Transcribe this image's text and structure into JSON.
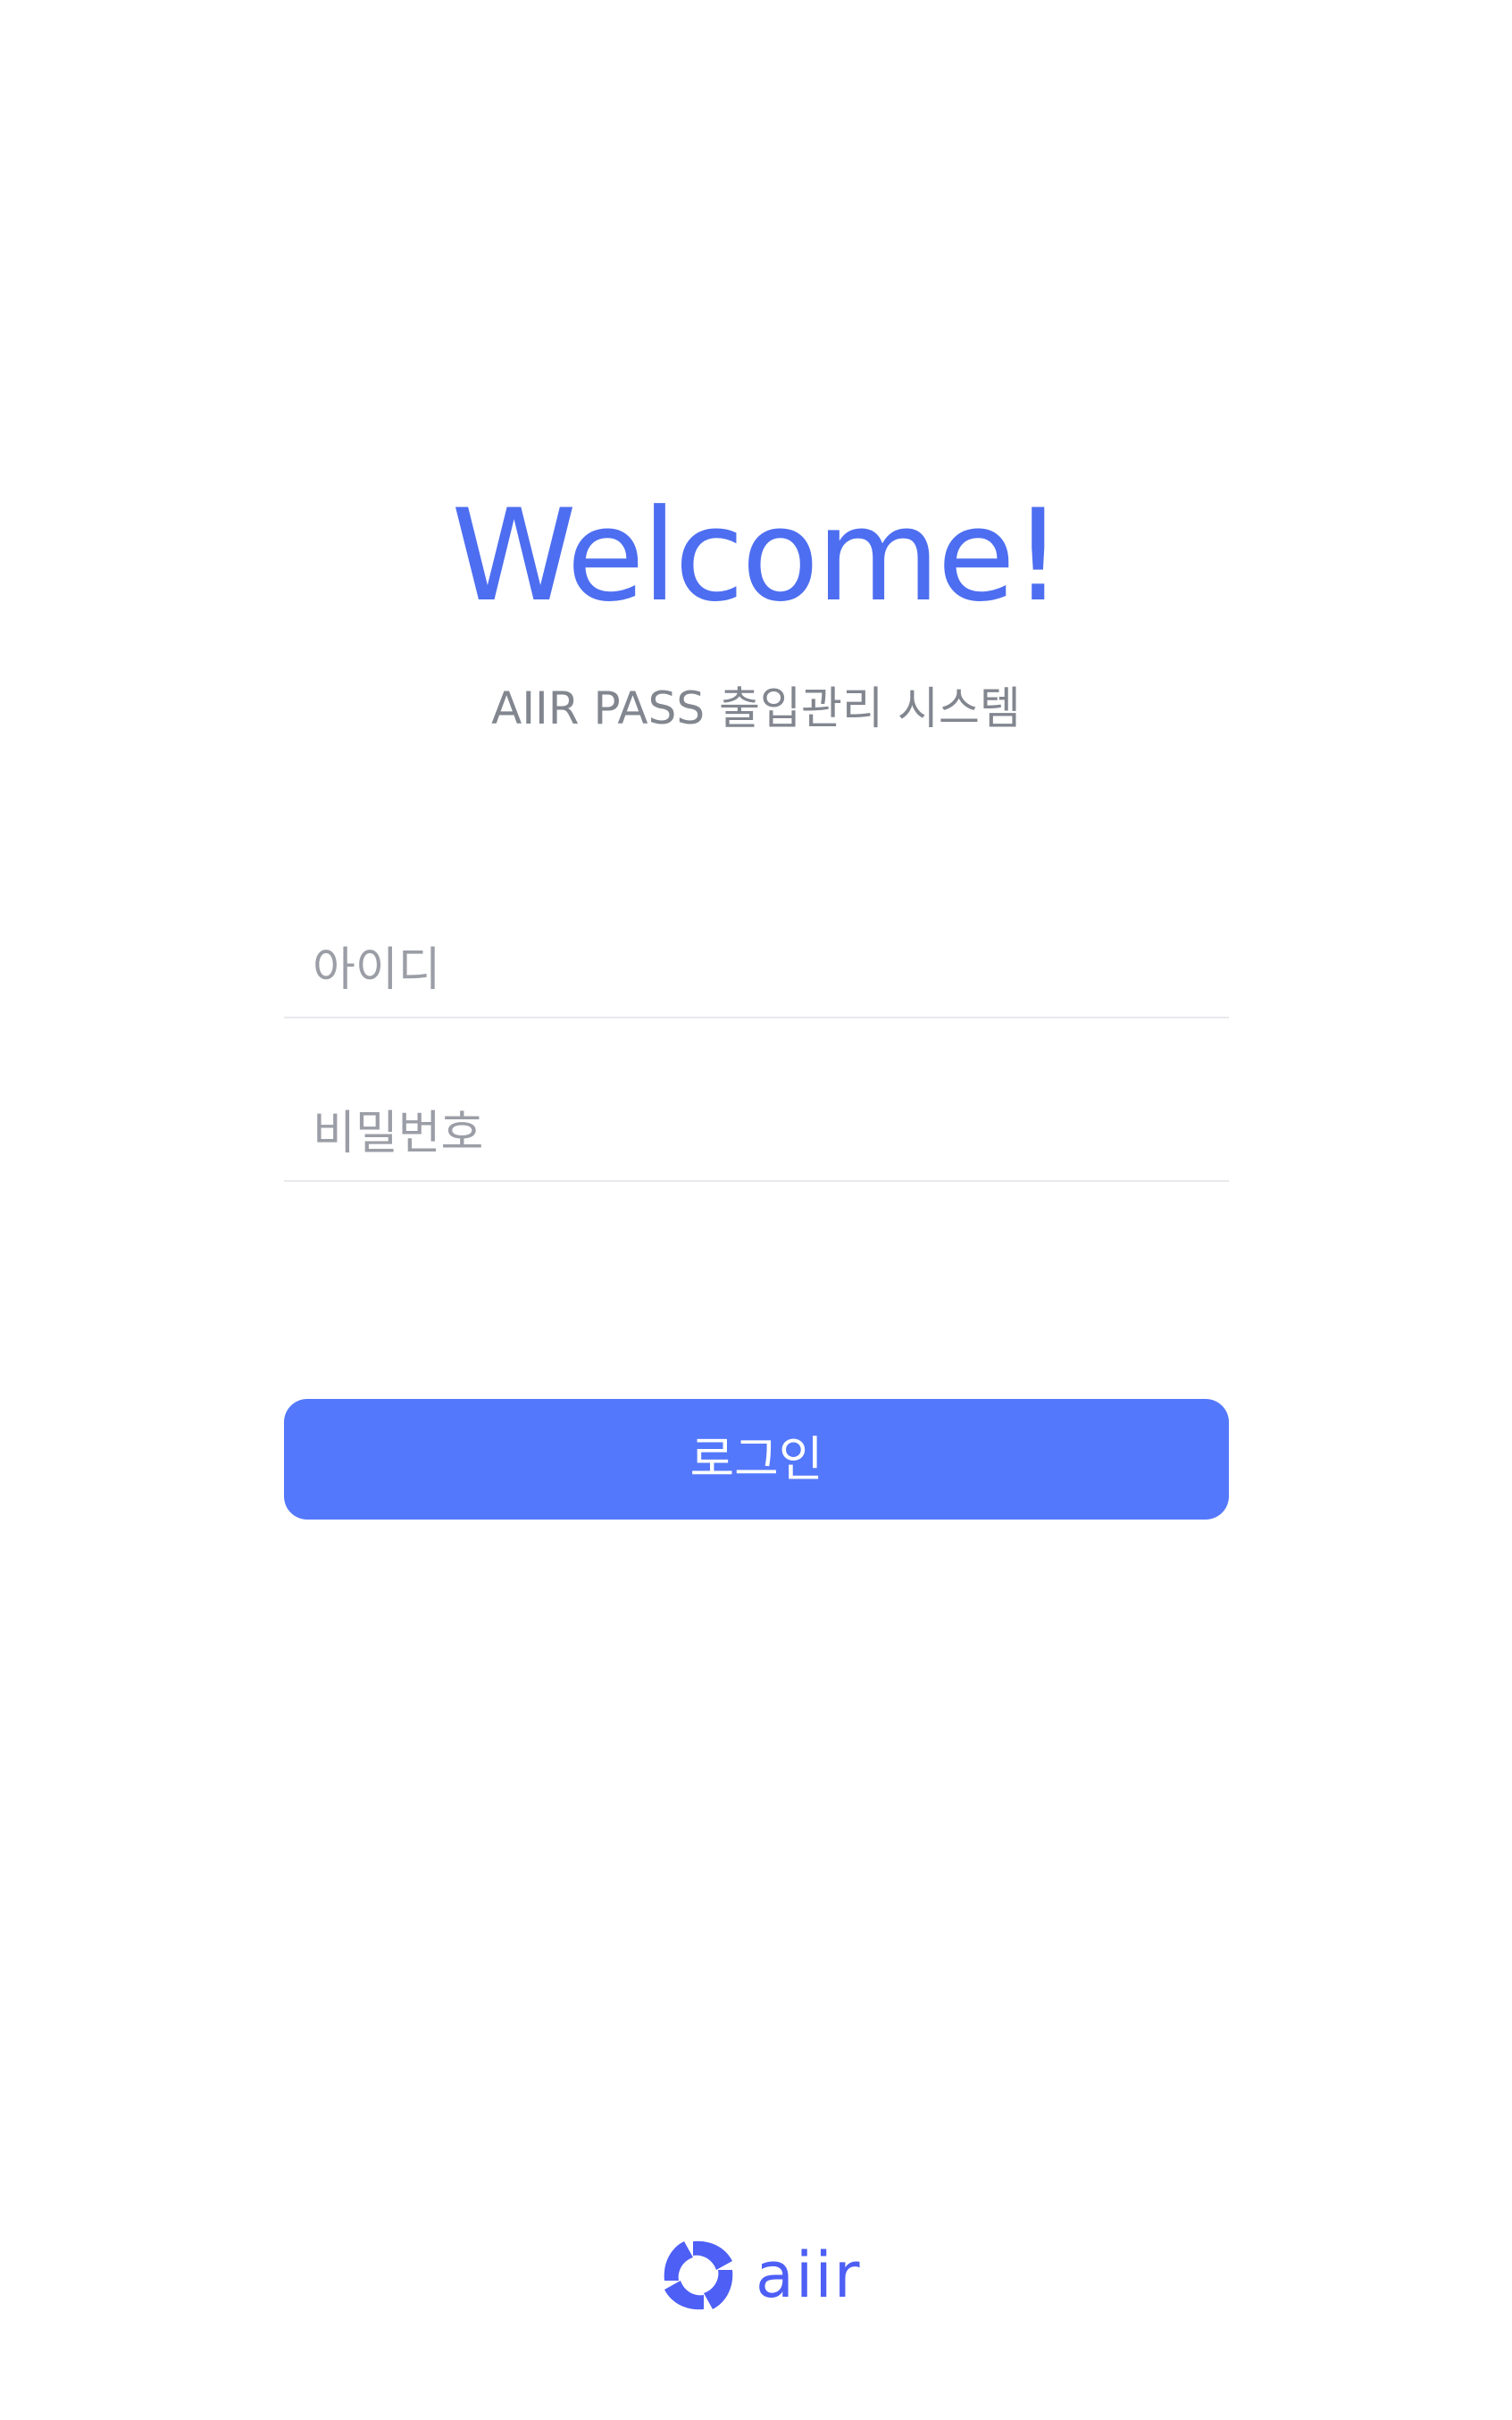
{
  "welcome": {
    "title": "Welcome!",
    "subtitle": "AIIR PASS 출입관리 시스템"
  },
  "form": {
    "id_placeholder": "아이디",
    "id_value": "",
    "password_placeholder": "비밀번호",
    "password_value": "",
    "login_label": "로그인"
  },
  "footer": {
    "brand": "aiir",
    "logo_icon": "aiir-logo-icon"
  },
  "colors": {
    "accent": "#5478fb",
    "title": "#4d6ef0",
    "subtitle": "#82868f",
    "placeholder": "#9b9ea6",
    "divider": "#e8e9ec",
    "brand": "#4d5ff5"
  }
}
